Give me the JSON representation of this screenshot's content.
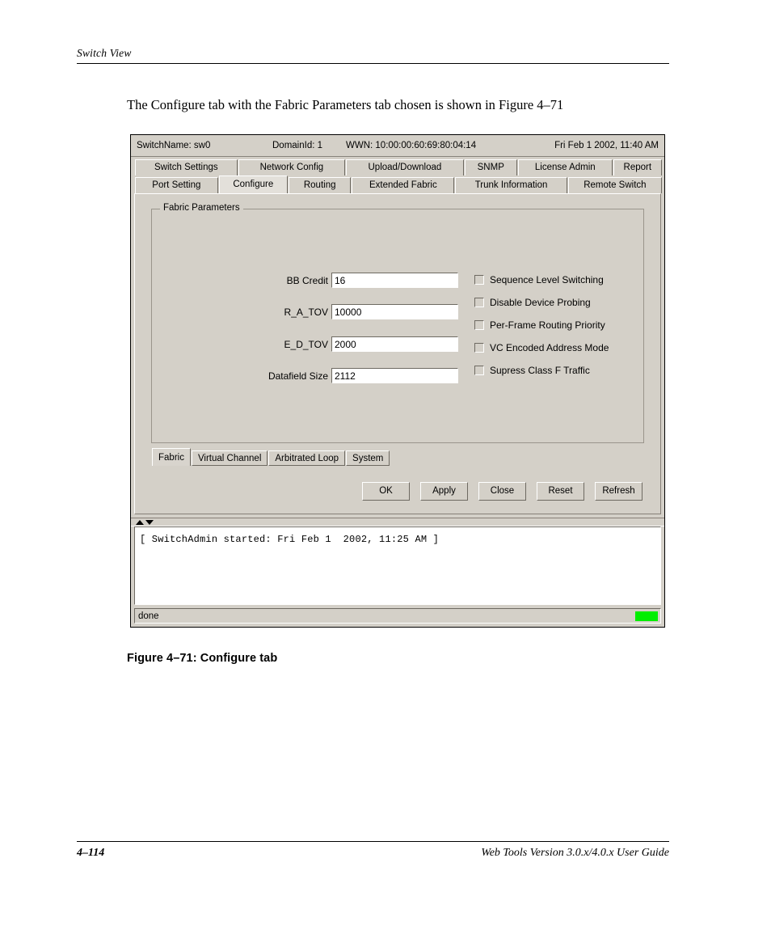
{
  "document": {
    "running_header": "Switch View",
    "paragraph": "The Configure tab with the Fabric Parameters tab chosen is shown in Figure 4–71",
    "figure_caption": "Figure 4–71:  Configure tab",
    "footer_page_number": "4–114",
    "footer_guide_title": "Web Tools Version 3.0.x/4.0.x User Guide"
  },
  "app": {
    "info_bar": {
      "switch_name": "SwitchName: sw0",
      "domain_id": "DomainId: 1",
      "wwn": "WWN: 10:00:00:60:69:80:04:14",
      "datetime": "Fri Feb 1  2002, 11:40 AM"
    },
    "tabs_row1": [
      {
        "label": "Switch Settings",
        "selected": false,
        "width": 128
      },
      {
        "label": "Network Config",
        "selected": false,
        "width": 134
      },
      {
        "label": "Upload/Download",
        "selected": false,
        "width": 147
      },
      {
        "label": "SNMP",
        "selected": false,
        "width": 66
      },
      {
        "label": "License Admin",
        "selected": false,
        "width": 118
      },
      {
        "label": "Report",
        "selected": false,
        "width": 61
      }
    ],
    "tabs_row2": [
      {
        "label": "Port Setting",
        "selected": false,
        "width": 106
      },
      {
        "label": "Configure",
        "selected": true,
        "width": 88
      },
      {
        "label": "Routing",
        "selected": false,
        "width": 80
      },
      {
        "label": "Extended Fabric",
        "selected": false,
        "width": 131
      },
      {
        "label": "Trunk Information",
        "selected": false,
        "width": 143
      },
      {
        "label": "Remote Switch",
        "selected": false,
        "width": 120
      }
    ],
    "group_box": {
      "title": "Fabric Parameters"
    },
    "fields": [
      {
        "label": "BB Credit",
        "value": "16"
      },
      {
        "label": "R_A_TOV",
        "value": "10000"
      },
      {
        "label": "E_D_TOV",
        "value": "2000"
      },
      {
        "label": "Datafield Size",
        "value": "2112"
      }
    ],
    "checkboxes": [
      {
        "label": "Sequence Level Switching",
        "checked": false
      },
      {
        "label": "Disable Device Probing",
        "checked": false
      },
      {
        "label": "Per-Frame Routing Priority",
        "checked": false
      },
      {
        "label": "VC Encoded Address Mode",
        "checked": false
      },
      {
        "label": "Supress Class F Traffic",
        "checked": false
      }
    ],
    "subtabs": [
      {
        "label": "Fabric",
        "selected": true
      },
      {
        "label": "Virtual Channel",
        "selected": false
      },
      {
        "label": "Arbitrated Loop",
        "selected": false
      },
      {
        "label": "System",
        "selected": false
      }
    ],
    "buttons": [
      {
        "label": "OK"
      },
      {
        "label": "Apply"
      },
      {
        "label": "Close"
      },
      {
        "label": "Reset"
      },
      {
        "label": "Refresh"
      }
    ],
    "console": {
      "lines": [
        "[ SwitchAdmin started: Fri Feb 1  2002, 11:25 AM ]"
      ]
    },
    "status_bar": {
      "text": "done",
      "led_color": "#00ee00"
    }
  }
}
